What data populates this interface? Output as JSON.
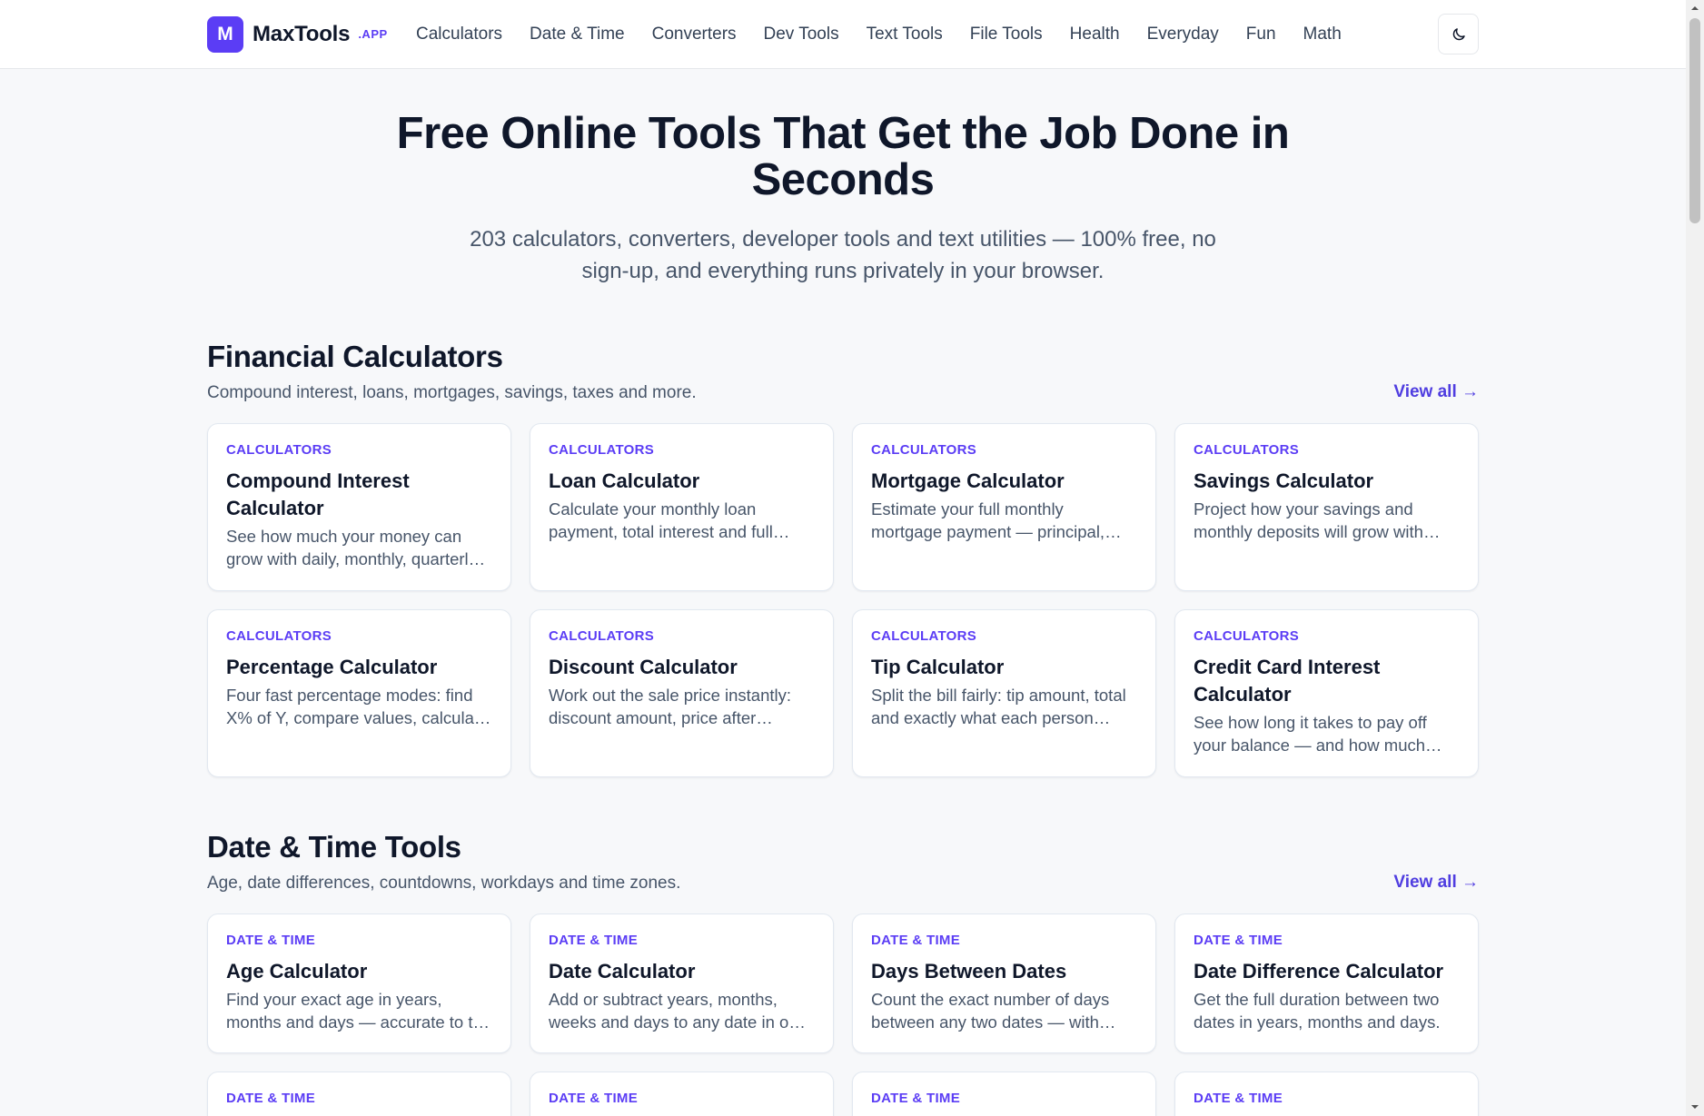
{
  "header": {
    "logo_letter": "M",
    "brand_name": "MaxTools",
    "brand_tld": ".APP",
    "nav": [
      "Calculators",
      "Date & Time",
      "Converters",
      "Dev Tools",
      "Text Tools",
      "File Tools",
      "Health",
      "Everyday",
      "Fun",
      "Math"
    ],
    "theme_icon": "moon-icon"
  },
  "hero": {
    "title": "Free Online Tools That Get the Job Done in Seconds",
    "subtitle": "203 calculators, converters, developer tools and text utilities — 100% free, no sign-up, and everything runs privately in your browser."
  },
  "sections": [
    {
      "title": "Financial Calculators",
      "description": "Compound interest, loans, mortgages, savings, taxes and more.",
      "view_all": "View all →",
      "cards": [
        {
          "category": "Calculators",
          "title": "Compound Interest Calculator",
          "description": "See how much your money can grow with daily, monthly, quarterly or yearly compounding."
        },
        {
          "category": "Calculators",
          "title": "Loan Calculator",
          "description": "Calculate your monthly loan payment, total interest and full amortization schedule."
        },
        {
          "category": "Calculators",
          "title": "Mortgage Calculator",
          "description": "Estimate your full monthly mortgage payment — principal, interest, taxes and insurance."
        },
        {
          "category": "Calculators",
          "title": "Savings Calculator",
          "description": "Project how your savings and monthly deposits will grow with interest over time."
        },
        {
          "category": "Calculators",
          "title": "Percentage Calculator",
          "description": "Four fast percentage modes: find X% of Y, compare values, calculate change and more."
        },
        {
          "category": "Calculators",
          "title": "Discount Calculator",
          "description": "Work out the sale price instantly: discount amount, price after discount and savings."
        },
        {
          "category": "Calculators",
          "title": "Tip Calculator",
          "description": "Split the bill fairly: tip amount, total and exactly what each person owes."
        },
        {
          "category": "Calculators",
          "title": "Credit Card Interest Calculator",
          "description": "See how long it takes to pay off your balance — and how much interest you will pay."
        }
      ]
    },
    {
      "title": "Date & Time Tools",
      "description": "Age, date differences, countdowns, workdays and time zones.",
      "view_all": "View all →",
      "cards": [
        {
          "category": "Date & Time",
          "title": "Age Calculator",
          "description": "Find your exact age in years, months and days — accurate to the day."
        },
        {
          "category": "Date & Time",
          "title": "Date Calculator",
          "description": "Add or subtract years, months, weeks and days to any date in one click."
        },
        {
          "category": "Date & Time",
          "title": "Days Between Dates",
          "description": "Count the exact number of days between any two dates — with weekends option."
        },
        {
          "category": "Date & Time",
          "title": "Date Difference Calculator",
          "description": "Get the full duration between two dates in years, months and days."
        }
      ],
      "stub_categories": [
        "Date & Time",
        "Date & Time",
        "Date & Time",
        "Date & Time"
      ]
    }
  ]
}
